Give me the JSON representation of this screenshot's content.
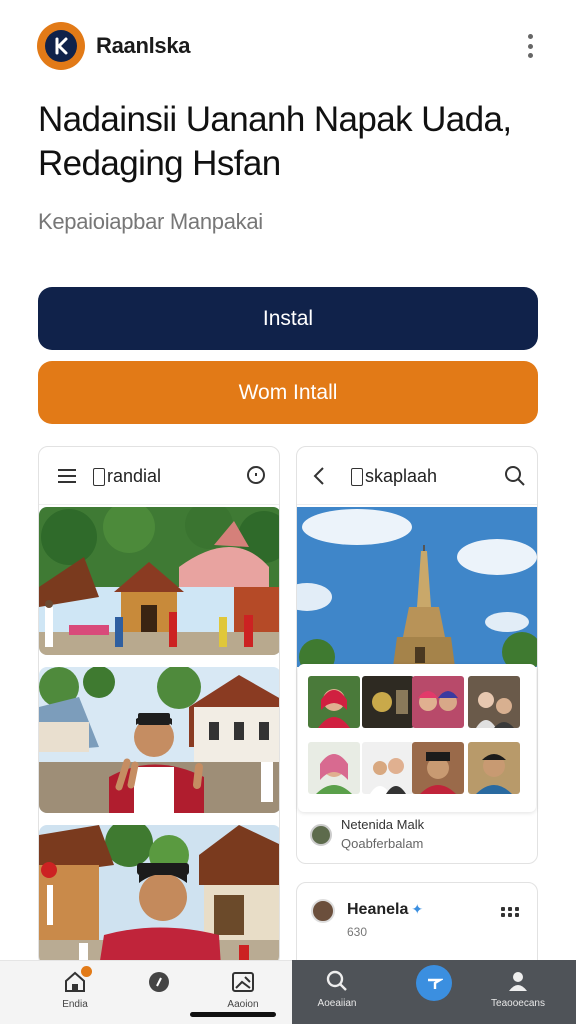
{
  "app": {
    "name": "Raanlska"
  },
  "hero": {
    "headline": "Nadainsii Uananh Napak Uada, Redaging Hsfan",
    "subtitle": "Kepaioiapbar Manpakai"
  },
  "buttons": {
    "install": "Instal",
    "secondary": "Wom Intall"
  },
  "card_left": {
    "title": "randial"
  },
  "card_right": {
    "title": "skaplaah",
    "meta_line1": "Netenida Malk",
    "meta_line2": "Qoabferbalam"
  },
  "card_bottom": {
    "name": "Heanela",
    "sub": "630"
  },
  "nav": {
    "items": [
      {
        "label": "Endia",
        "icon": "home-icon"
      },
      {
        "label": "",
        "icon": "chat-icon"
      },
      {
        "label": "Aaoion",
        "icon": "image-icon"
      },
      {
        "label": "Aoeaiian",
        "icon": "search-icon"
      },
      {
        "label": "",
        "icon": "send-icon"
      },
      {
        "label": "Teaooecans",
        "icon": "profile-icon"
      }
    ]
  },
  "colors": {
    "navy": "#10224a",
    "orange": "#e27a17",
    "blue": "#3b8fe0"
  }
}
